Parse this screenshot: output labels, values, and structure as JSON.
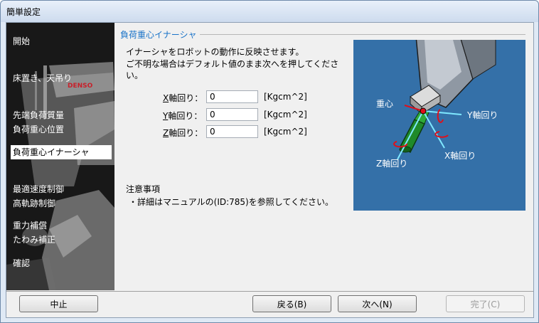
{
  "window": {
    "title": "簡単設定"
  },
  "sidebar": {
    "items": [
      {
        "label": "開始"
      },
      {
        "label": "床置き、天吊り"
      },
      {
        "label": "先端負荷質量"
      },
      {
        "label": "負荷重心位置"
      },
      {
        "label": "負荷重心イナーシャ",
        "active": true
      },
      {
        "label": "最適速度制御"
      },
      {
        "label": "高軌跡制御"
      },
      {
        "label": "重力補償"
      },
      {
        "label": "たわみ補正"
      },
      {
        "label": "確認"
      }
    ],
    "logo_text": "DENSO"
  },
  "main": {
    "group_title": "負荷重心イナーシャ",
    "description_lines": [
      "イナーシャをロボットの動作に反映させます。",
      "ご不明な場合はデフォルト値のまま次へを押してくださ",
      "い。"
    ],
    "fields": [
      {
        "accel": "X",
        "label": "軸回り：",
        "value": "0",
        "unit": "[Kgcm^2]"
      },
      {
        "accel": "Y",
        "label": "軸回り：",
        "value": "0",
        "unit": "[Kgcm^2]"
      },
      {
        "accel": "Z",
        "label": "軸回り：",
        "value": "0",
        "unit": "[Kgcm^2]"
      }
    ],
    "note_title": "注意事項",
    "note_text": "・詳細はマニュアルの(ID:785)を参照してください。"
  },
  "diagram": {
    "center_label": "重心",
    "y_label": "Y軸回り",
    "x_label": "X軸回り",
    "z_label": "Z軸回り",
    "bg_color": "#3470a8",
    "axis_color": "#7fe8ff",
    "marker_color": "#e0101a"
  },
  "buttons": {
    "cancel": "中止",
    "back": "戻る(B)",
    "next": "次へ(N)",
    "finish": "完了(C)"
  }
}
